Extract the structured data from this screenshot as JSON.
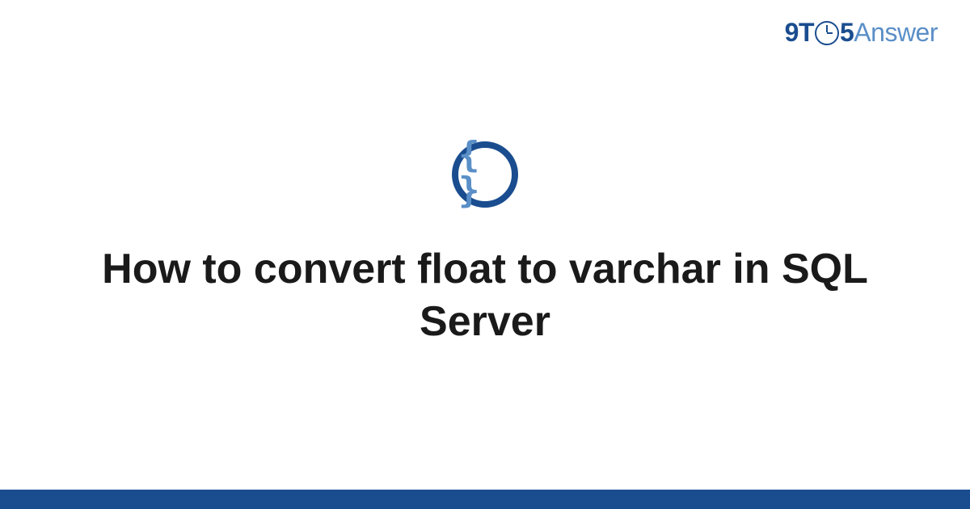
{
  "logo": {
    "part1": "9T",
    "part2": "5",
    "part3": "Answer"
  },
  "icon": {
    "braces": "{ }",
    "name": "code-braces-icon"
  },
  "title": "How to convert float to varchar in SQL Server",
  "colors": {
    "primary": "#1a4d8f",
    "secondary": "#5a8fc7",
    "text": "#1a1a1a"
  }
}
